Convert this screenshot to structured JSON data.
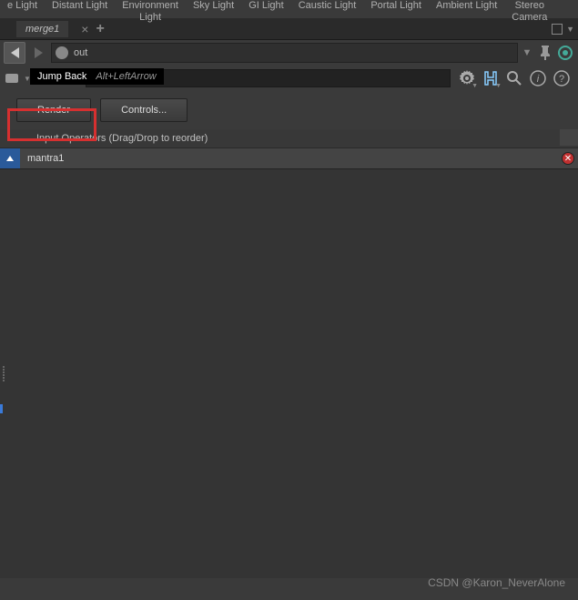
{
  "shelf": {
    "items": [
      "e Light",
      "Distant Light",
      "Environment\nLight",
      "Sky Light",
      "GI Light",
      "Caustic Light",
      "Portal Light",
      "Ambient Light",
      "Stereo\nCamera"
    ]
  },
  "tabs": {
    "active": "merge1"
  },
  "nav": {
    "path": "out"
  },
  "tooltip": {
    "label": "Jump Back",
    "shortcut": "Alt+LeftArrow"
  },
  "node": {
    "type": "Merge",
    "name": "merge1"
  },
  "buttons": {
    "render": "Render",
    "controls": "Controls..."
  },
  "list": {
    "header": "Input Operators (Drag/Drop to reorder)",
    "rows": [
      {
        "name": "mantra1"
      }
    ]
  },
  "watermark": "CSDN @Karon_NeverAlone"
}
